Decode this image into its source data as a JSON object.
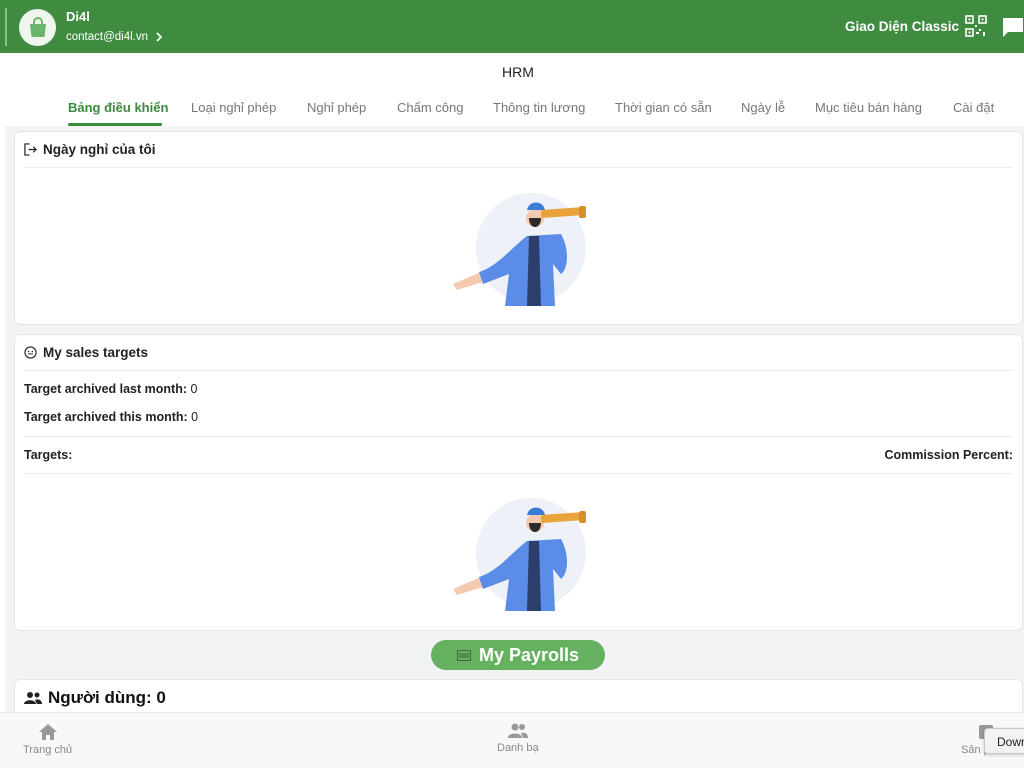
{
  "header": {
    "shop_name": "Di4l",
    "email": "contact@di4l.vn",
    "theme_label": "Giao Diện Classic",
    "bg_color": "#3f8c40"
  },
  "page": {
    "title": "HRM"
  },
  "tabs": [
    {
      "label": "Bảng điều khiển",
      "active": true
    },
    {
      "label": "Loại nghỉ phép"
    },
    {
      "label": "Nghỉ phép"
    },
    {
      "label": "Chấm công"
    },
    {
      "label": "Thông tin lương"
    },
    {
      "label": "Thời gian có sẵn"
    },
    {
      "label": "Ngày lễ"
    },
    {
      "label": "Mục tiêu bán hàng"
    },
    {
      "label": "Cài đặt"
    }
  ],
  "leave_card": {
    "title": "Ngày nghỉ của tôi"
  },
  "sales_card": {
    "title": "My sales targets",
    "last_month_label": "Target archived last month:",
    "last_month_value": "0",
    "this_month_label": "Target archived this month:",
    "this_month_value": "0",
    "targets_label": "Targets:",
    "commission_label": "Commission Percent:"
  },
  "payroll": {
    "label": "My Payrolls"
  },
  "users": {
    "title": "Người dùng: 0"
  },
  "bottom_nav": [
    {
      "label": "Trang chủ",
      "icon": "home-icon"
    },
    {
      "label": "Danh bạ",
      "icon": "contacts-icon"
    },
    {
      "label": "Sản phẩm",
      "icon": "product-icon"
    }
  ],
  "tooltip": {
    "text": "Download"
  },
  "colors": {
    "accent": "#3a8a3c",
    "button": "#66b160"
  }
}
